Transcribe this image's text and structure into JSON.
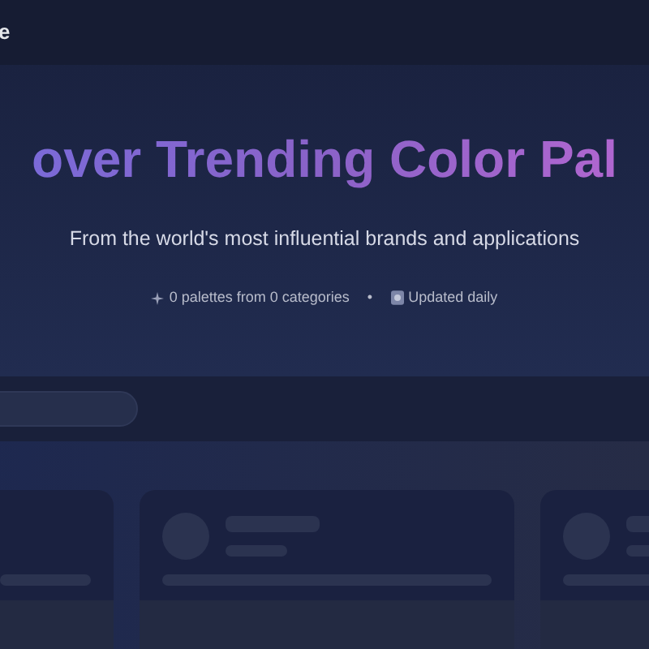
{
  "header": {
    "logo_text": "e"
  },
  "hero": {
    "title": "over Trending Color Pal",
    "subtitle": "From the world's most influential brands and applications",
    "stats": [
      {
        "kind": "count",
        "text": "0 palettes from 0 categories"
      },
      {
        "kind": "separator",
        "text": "•"
      },
      {
        "kind": "updated",
        "text": "Updated daily"
      }
    ]
  }
}
